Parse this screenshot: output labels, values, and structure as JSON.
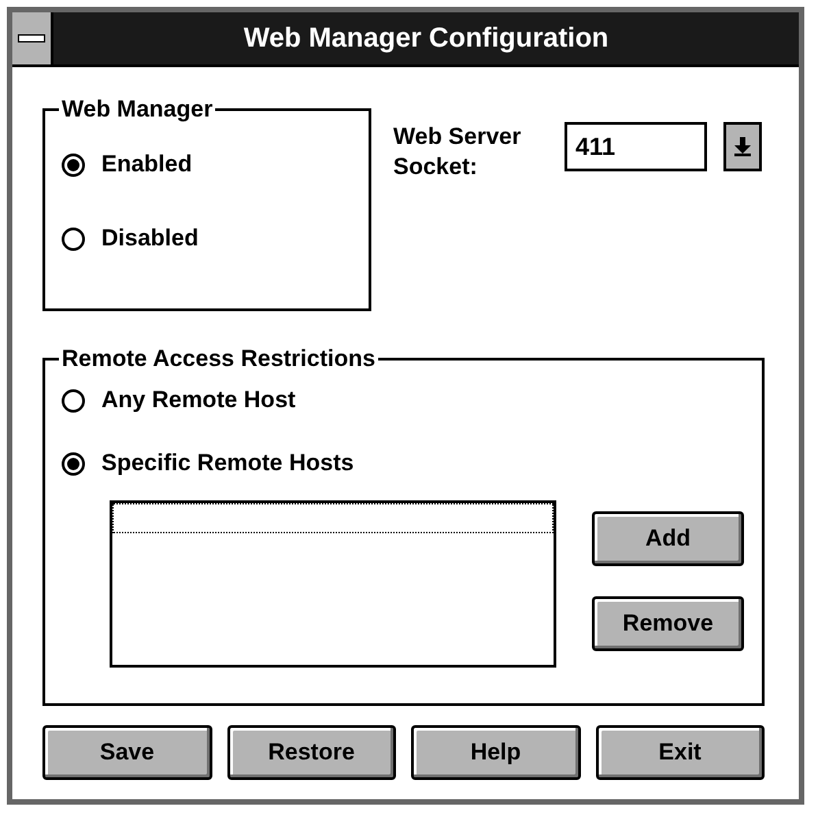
{
  "window": {
    "title": "Web Manager Configuration"
  },
  "web_manager": {
    "title": "Web Manager",
    "options": [
      {
        "label": "Enabled",
        "selected": true
      },
      {
        "label": "Disabled",
        "selected": false
      }
    ]
  },
  "socket": {
    "label_lines": [
      "Web Server",
      "Socket:"
    ],
    "value": "411"
  },
  "remote_access": {
    "title": "Remote Access Restrictions",
    "options": [
      {
        "label": "Any Remote Host",
        "selected": false
      },
      {
        "label": "Specific Remote Hosts",
        "selected": true
      }
    ],
    "buttons": [
      {
        "label": "Add"
      },
      {
        "label": "Remove"
      }
    ]
  },
  "buttons": [
    {
      "label": "Save"
    },
    {
      "label": "Restore"
    },
    {
      "label": "Help"
    },
    {
      "label": "Exit"
    }
  ]
}
